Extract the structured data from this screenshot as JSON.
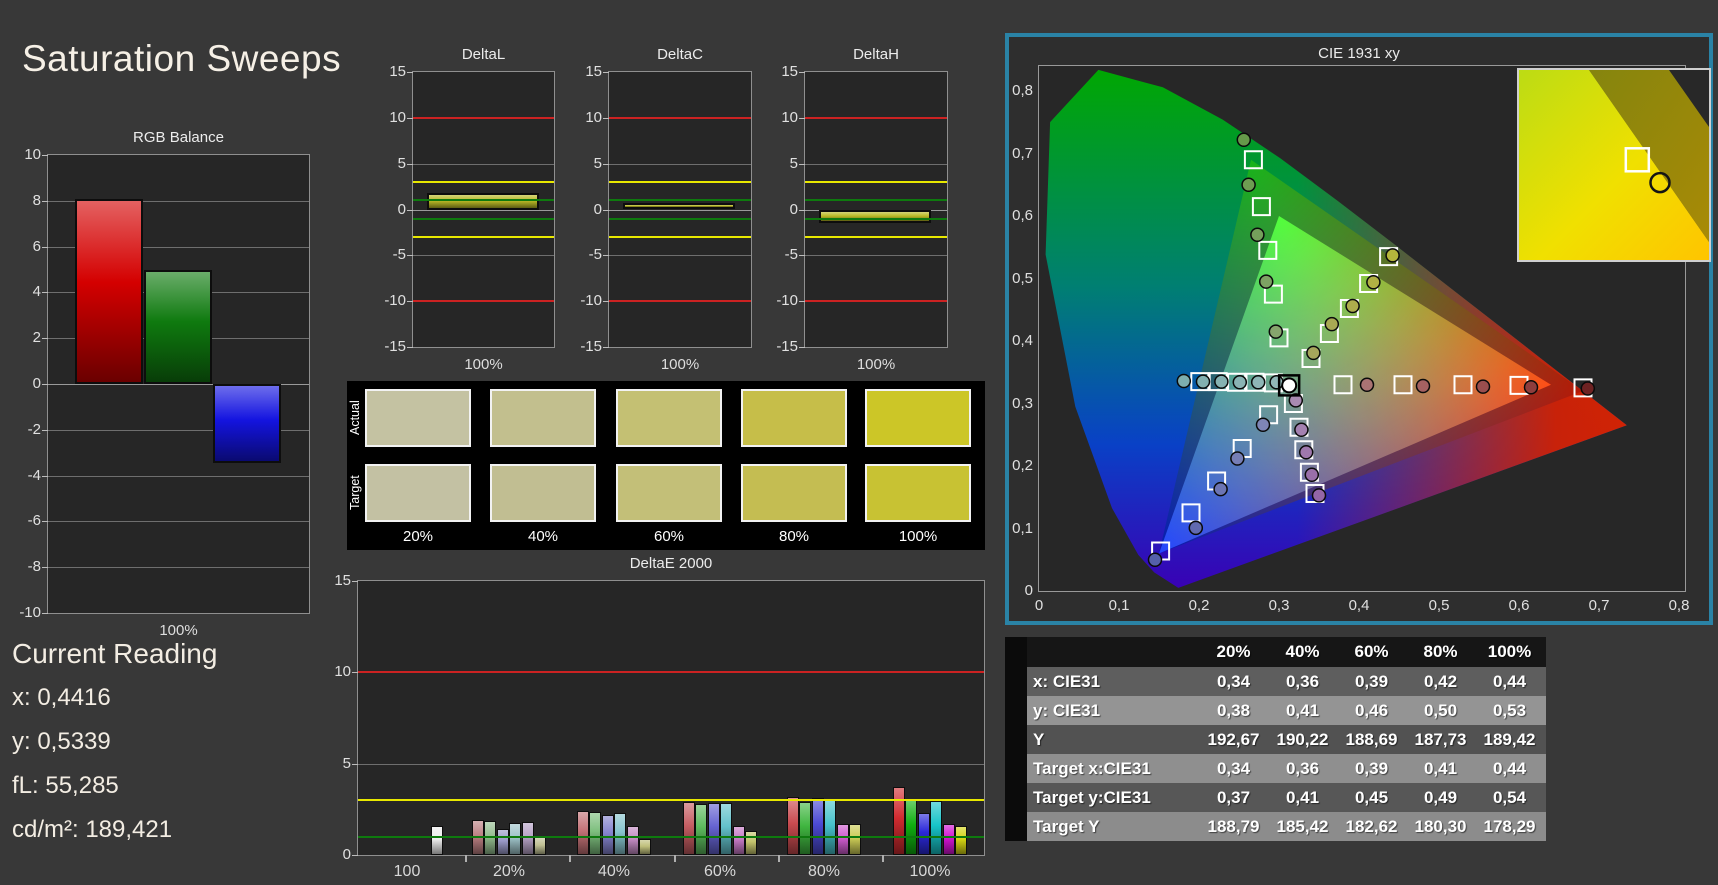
{
  "title": "Saturation Sweeps",
  "current_reading": {
    "title": "Current Reading",
    "lines": [
      "x: 0,4416",
      "y: 0,5339",
      "fL: 55,285",
      "cd/m²: 189,421"
    ]
  },
  "swatches": {
    "row_labels": [
      "Actual",
      "Target"
    ],
    "percent_labels": [
      "20%",
      "40%",
      "60%",
      "80%",
      "100%"
    ],
    "actual_colors": [
      "#c4c2a2",
      "#c2bf8e",
      "#c4c073",
      "#c6be49",
      "#ccc627"
    ],
    "target_colors": [
      "#c3c1a3",
      "#c1be92",
      "#c3bf78",
      "#c4bd52",
      "#c8c233"
    ]
  },
  "chart_data": [
    {
      "id": "rgb_balance",
      "type": "bar",
      "title": "RGB Balance",
      "xlabel": "100%",
      "categories": [
        "Red",
        "Green",
        "Blue"
      ],
      "values": [
        8.1,
        5.0,
        -3.45
      ],
      "bar_colors": [
        "#d40000",
        "#0f7a0f",
        "#1414e0"
      ],
      "ylim": [
        -10,
        10
      ],
      "ytick_step": 2,
      "grid": true
    },
    {
      "id": "delta_l",
      "type": "bar",
      "title": "DeltaL",
      "xlabel": "100%",
      "categories": [
        "100%"
      ],
      "values": [
        1.8
      ],
      "bar_colors": [
        "#b9b925"
      ],
      "ylim": [
        -15,
        15
      ],
      "ytick_step": 5,
      "limit_lines": [
        {
          "value": 10,
          "color": "#cc2222"
        },
        {
          "value": -10,
          "color": "#cc2222"
        },
        {
          "value": 3,
          "color": "#e8e800"
        },
        {
          "value": -3,
          "color": "#e8e800"
        },
        {
          "value": 1,
          "color": "#0e7a0e"
        },
        {
          "value": -1,
          "color": "#0e7a0e"
        }
      ]
    },
    {
      "id": "delta_c",
      "type": "bar",
      "title": "DeltaC",
      "xlabel": "100%",
      "categories": [
        "100%"
      ],
      "values": [
        0.7
      ],
      "bar_colors": [
        "#b9b925"
      ],
      "ylim": [
        -15,
        15
      ],
      "ytick_step": 5,
      "limit_lines": [
        {
          "value": 10,
          "color": "#cc2222"
        },
        {
          "value": -10,
          "color": "#cc2222"
        },
        {
          "value": 3,
          "color": "#e8e800"
        },
        {
          "value": -3,
          "color": "#e8e800"
        },
        {
          "value": 1,
          "color": "#0e7a0e"
        },
        {
          "value": -1,
          "color": "#0e7a0e"
        }
      ]
    },
    {
      "id": "delta_h",
      "type": "bar",
      "title": "DeltaH",
      "xlabel": "100%",
      "categories": [
        "100%"
      ],
      "values": [
        -1.5
      ],
      "bar_colors": [
        "#b9b925"
      ],
      "ylim": [
        -15,
        15
      ],
      "ytick_step": 5,
      "limit_lines": [
        {
          "value": 10,
          "color": "#cc2222"
        },
        {
          "value": -10,
          "color": "#cc2222"
        },
        {
          "value": 3,
          "color": "#e8e800"
        },
        {
          "value": -3,
          "color": "#e8e800"
        },
        {
          "value": 1,
          "color": "#0e7a0e"
        },
        {
          "value": -1,
          "color": "#0e7a0e"
        }
      ]
    },
    {
      "id": "delta_e_2000",
      "type": "bar",
      "title": "DeltaE 2000",
      "ylim": [
        0,
        15
      ],
      "ytick_step": 5,
      "limit_lines": [
        {
          "value": 10,
          "color": "#cc2222"
        },
        {
          "value": 3,
          "color": "#e8e800"
        },
        {
          "value": 1,
          "color": "#0e7a0e"
        }
      ],
      "groups": [
        {
          "label": "100",
          "values": [
            1.6
          ],
          "colors": [
            "#ededed"
          ]
        },
        {
          "label": "20%",
          "values": [
            1.9,
            1.85,
            1.4,
            1.75,
            1.8,
            1.0
          ],
          "colors": [
            "#bb7f82",
            "#94bd8f",
            "#9a99c8",
            "#9fc4c9",
            "#b7a2c6",
            "#bfbf93"
          ]
        },
        {
          "label": "40%",
          "values": [
            2.4,
            2.35,
            2.2,
            2.3,
            1.6,
            0.85
          ],
          "colors": [
            "#c37176",
            "#7dbf7d",
            "#8482cd",
            "#86c4cd",
            "#c38bc3",
            "#bfbf7c"
          ]
        },
        {
          "label": "60%",
          "values": [
            2.9,
            2.8,
            2.85,
            2.85,
            1.6,
            1.3
          ],
          "colors": [
            "#c55d62",
            "#5dba5d",
            "#6663d1",
            "#63c1cb",
            "#c679c6",
            "#c3c36c"
          ]
        },
        {
          "label": "80%",
          "values": [
            3.2,
            2.9,
            3.1,
            3.0,
            1.7,
            1.7
          ],
          "colors": [
            "#ca4b50",
            "#40b640",
            "#4c4ad4",
            "#46c2cc",
            "#ce5bce",
            "#cccc56"
          ]
        },
        {
          "label": "100%",
          "values": [
            3.7,
            3.0,
            2.3,
            2.95,
            1.7,
            1.6
          ],
          "colors": [
            "#d12b30",
            "#10b010",
            "#2c29da",
            "#17c4c8",
            "#d213d2",
            "#d4d413"
          ]
        }
      ]
    },
    {
      "id": "cie_1931",
      "type": "scatter",
      "title": "CIE 1931 xy",
      "xlim": [
        0,
        0.8
      ],
      "ylim": [
        0,
        0.84
      ],
      "xticks": [
        "0",
        "0,1",
        "0,2",
        "0,3",
        "0,4",
        "0,5",
        "0,6",
        "0,7",
        "0,8"
      ],
      "yticks": [
        "0",
        "0,1",
        "0,2",
        "0,3",
        "0,4",
        "0,5",
        "0,6",
        "0,7",
        "0,8"
      ],
      "white_point": {
        "target": [
          0.3127,
          0.329
        ],
        "measured": [
          0.3127,
          0.329
        ]
      },
      "gamut_triangles": {
        "reference_srgb": [
          [
            0.64,
            0.33
          ],
          [
            0.3,
            0.6
          ],
          [
            0.15,
            0.06
          ]
        ],
        "target_p3": [
          [
            0.68,
            0.32
          ],
          [
            0.265,
            0.69
          ],
          [
            0.15,
            0.06
          ]
        ]
      },
      "sweeps": [
        {
          "name": "red",
          "targets": [
            [
              0.38,
              0.33
            ],
            [
              0.455,
              0.33
            ],
            [
              0.53,
              0.33
            ],
            [
              0.6,
              0.329
            ],
            [
              0.68,
              0.325
            ]
          ],
          "measured": [
            [
              0.41,
              0.33
            ],
            [
              0.48,
              0.328
            ],
            [
              0.555,
              0.327
            ],
            [
              0.615,
              0.326
            ],
            [
              0.686,
              0.324
            ]
          ],
          "measured_colors": [
            "#aa7373",
            "#a56161",
            "#9a4e4e",
            "#8e3d3d",
            "#6e2222"
          ]
        },
        {
          "name": "green",
          "targets": [
            [
              0.3,
              0.405
            ],
            [
              0.293,
              0.475
            ],
            [
              0.286,
              0.545
            ],
            [
              0.278,
              0.615
            ],
            [
              0.268,
              0.69
            ]
          ],
          "measured": [
            [
              0.296,
              0.415
            ],
            [
              0.284,
              0.495
            ],
            [
              0.273,
              0.57
            ],
            [
              0.262,
              0.65
            ],
            [
              0.256,
              0.722
            ]
          ],
          "measured_colors": [
            "#86a56d",
            "#7da263",
            "#75a05b",
            "#6d9d52",
            "#66994a"
          ]
        },
        {
          "name": "blue",
          "targets": [
            [
              0.287,
              0.282
            ],
            [
              0.254,
              0.228
            ],
            [
              0.222,
              0.176
            ],
            [
              0.19,
              0.125
            ],
            [
              0.152,
              0.064
            ]
          ],
          "measured": [
            [
              0.28,
              0.266
            ],
            [
              0.248,
              0.212
            ],
            [
              0.227,
              0.163
            ],
            [
              0.196,
              0.101
            ],
            [
              0.145,
              0.05
            ]
          ],
          "measured_colors": [
            "#7e85b6",
            "#767eb6",
            "#6c75b4",
            "#616ab0",
            "#5560aa"
          ]
        },
        {
          "name": "cyan",
          "targets": [
            [
              0.293,
              0.333
            ],
            [
              0.27,
              0.334
            ],
            [
              0.247,
              0.334
            ],
            [
              0.224,
              0.335
            ],
            [
              0.201,
              0.335
            ]
          ],
          "measured": [
            [
              0.297,
              0.334
            ],
            [
              0.274,
              0.334
            ],
            [
              0.251,
              0.334
            ],
            [
              0.228,
              0.335
            ],
            [
              0.205,
              0.335
            ],
            [
              0.181,
              0.336
            ]
          ],
          "measured_colors": [
            "#92b8b8",
            "#8eb6b6",
            "#8ab4b4",
            "#86b2b2",
            "#82b0b0",
            "#7eaeae"
          ]
        },
        {
          "name": "magenta",
          "targets": [
            [
              0.318,
              0.3
            ],
            [
              0.325,
              0.262
            ],
            [
              0.331,
              0.226
            ],
            [
              0.338,
              0.19
            ],
            [
              0.345,
              0.156
            ]
          ],
          "measured": [
            [
              0.321,
              0.305
            ],
            [
              0.328,
              0.258
            ],
            [
              0.334,
              0.222
            ],
            [
              0.341,
              0.186
            ],
            [
              0.35,
              0.153
            ]
          ],
          "measured_colors": [
            "#a98ab2",
            "#a481b0",
            "#9f78ad",
            "#996fa9",
            "#9366a6"
          ]
        },
        {
          "name": "yellow",
          "targets": [
            [
              0.34,
              0.372
            ],
            [
              0.363,
              0.412
            ],
            [
              0.388,
              0.452
            ],
            [
              0.412,
              0.492
            ],
            [
              0.437,
              0.535
            ]
          ],
          "measured": [
            [
              0.343,
              0.381
            ],
            [
              0.366,
              0.427
            ],
            [
              0.392,
              0.456
            ],
            [
              0.418,
              0.494
            ],
            [
              0.442,
              0.537
            ]
          ],
          "measured_colors": [
            "#a6a65c",
            "#a9a954",
            "#adad4c",
            "#b1b144",
            "#b5b53c"
          ]
        }
      ],
      "inset": {
        "description": "zoom of yellow 100% point",
        "square": [
          0.62,
          0.47
        ],
        "circle": [
          0.7,
          0.54
        ]
      }
    },
    {
      "id": "sweep_table",
      "type": "table",
      "columns": [
        "20%",
        "40%",
        "60%",
        "80%",
        "100%"
      ],
      "rows": [
        {
          "label": "x: CIE31",
          "values": [
            "0,34",
            "0,36",
            "0,39",
            "0,42",
            "0,44"
          ]
        },
        {
          "label": "y: CIE31",
          "values": [
            "0,38",
            "0,41",
            "0,46",
            "0,50",
            "0,53"
          ]
        },
        {
          "label": "Y",
          "values": [
            "192,67",
            "190,22",
            "188,69",
            "187,73",
            "189,42"
          ]
        },
        {
          "label": "Target x:CIE31",
          "values": [
            "0,34",
            "0,36",
            "0,39",
            "0,41",
            "0,44"
          ]
        },
        {
          "label": "Target y:CIE31",
          "values": [
            "0,37",
            "0,41",
            "0,45",
            "0,49",
            "0,54"
          ]
        },
        {
          "label": "Target Y",
          "values": [
            "188,79",
            "185,42",
            "182,62",
            "180,30",
            "178,29"
          ]
        }
      ]
    }
  ]
}
